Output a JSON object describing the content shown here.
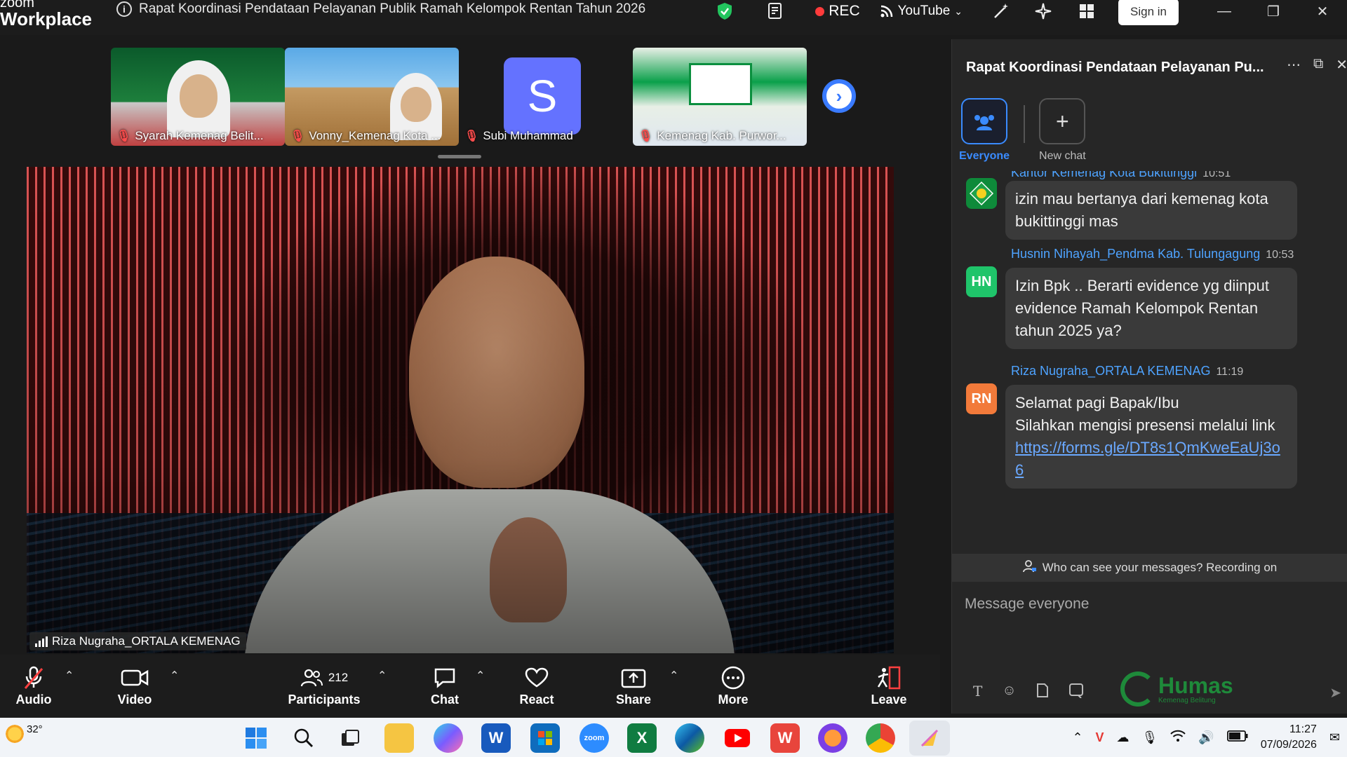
{
  "app": {
    "logo_line1": "zoom",
    "logo_line2": "Workplace"
  },
  "meeting": {
    "title": "Rapat Koordinasi Pendataan Pelayanan Publik Ramah Kelompok Rentan Tahun 2026"
  },
  "titlebar": {
    "rec_label": "REC",
    "stream_label": "YouTube",
    "signin_label": "Sign in"
  },
  "thumbnails": [
    {
      "name": "Syarah Kemenag Belit...",
      "muted": true
    },
    {
      "name": "Vonny_Kemenag Kota ...",
      "muted": true
    },
    {
      "name": "Subi Muhammad",
      "muted": true,
      "avatar_letter": "S"
    },
    {
      "name": "Kemenag Kab. Purwor...",
      "muted": true
    }
  ],
  "main_video": {
    "speaker": "Riza Nugraha_ORTALA KEMENAG"
  },
  "toolbar": {
    "audio": "Audio",
    "video": "Video",
    "participants": "Participants",
    "participants_count": "212",
    "chat": "Chat",
    "react": "React",
    "share": "Share",
    "more": "More",
    "leave": "Leave"
  },
  "chat": {
    "title": "Rapat Koordinasi Pendataan Pelayanan Pu...",
    "tabs": {
      "everyone": "Everyone",
      "new_chat": "New chat"
    },
    "messages": [
      {
        "sender": "Kantor Kemenag Kota Bukittinggi",
        "time": "10:51",
        "avatar": "",
        "avatar_color": "#0e8a3a",
        "text": "izin mau bertanya dari kemenag kota bukittinggi mas"
      },
      {
        "sender": "Husnin Nihayah_Pendma Kab. Tulungagung",
        "time": "10:53",
        "avatar": "HN",
        "avatar_color": "#1fc46a",
        "text": "Izin Bpk .. Berarti evidence yg diinput evidence Ramah Kelompok Rentan tahun 2025 ya?"
      },
      {
        "sender": "Riza Nugraha_ORTALA KEMENAG",
        "time": "11:19",
        "avatar": "RN",
        "avatar_color": "#f27a3a",
        "text_line1": "Selamat pagi Bapak/Ibu",
        "text_line2": "Silahkan mengisi presensi melalui link",
        "link": "https://forms.gle/DT8s1QmKweEaUj3o6"
      }
    ],
    "privacy_note": "Who can see your messages? Recording on",
    "input_placeholder": "Message everyone",
    "watermark": "Humas",
    "watermark_sub": "Kemenag Belitung"
  },
  "taskbar": {
    "temperature": "32°",
    "time": "11:27",
    "date": "07/09/2026"
  },
  "colors": {
    "accent": "#3a8bff",
    "link": "#6aa8ff",
    "rec": "#ff3b3b"
  }
}
